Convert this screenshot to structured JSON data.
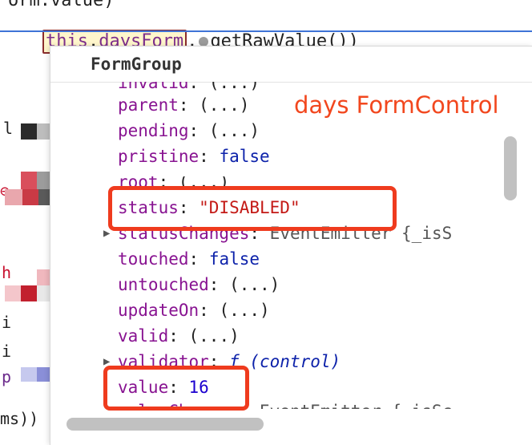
{
  "editor": {
    "top_partial": "orm.value)",
    "line_this": "this",
    "line_dot1": ".",
    "line_prop": "daysForm",
    "line_dot2": ".",
    "line_method": "getRawValue())",
    "left_snippets": [
      "l",
      "⊖",
      "h",
      "i",
      "i",
      "p",
      "ms))"
    ]
  },
  "popup": {
    "title": "FormGroup",
    "annotation": "days FormControl",
    "rows": [
      {
        "key": "invalid",
        "value": "(...)",
        "kind": "ellipsis"
      },
      {
        "key": "parent",
        "value": "(...)",
        "kind": "ellipsis"
      },
      {
        "key": "pending",
        "value": "(...)",
        "kind": "ellipsis"
      },
      {
        "key": "pristine",
        "value": "false",
        "kind": "bool"
      },
      {
        "key": "root",
        "value": "(...)",
        "kind": "ellipsis"
      },
      {
        "key": "status",
        "value": "\"DISABLED\"",
        "kind": "string"
      },
      {
        "key": "statusChanges",
        "value": "EventEmitter {_isS",
        "kind": "type"
      },
      {
        "key": "touched",
        "value": "false",
        "kind": "bool"
      },
      {
        "key": "untouched",
        "value": "(...)",
        "kind": "ellipsis"
      },
      {
        "key": "updateOn",
        "value": "(...)",
        "kind": "ellipsis"
      },
      {
        "key": "valid",
        "value": "(...)",
        "kind": "ellipsis"
      },
      {
        "key": "validator",
        "value": "f (control)",
        "kind": "fn"
      },
      {
        "key": "value",
        "value": "16",
        "kind": "number"
      },
      {
        "key": "valueChanges",
        "value": "EventEmitter {_isSc",
        "kind": "type"
      }
    ]
  },
  "colors": {
    "accent_red": "#ef3b1e",
    "key_purple": "#881391",
    "bool_blue": "#0d22aa",
    "string_red": "#c41a16"
  }
}
